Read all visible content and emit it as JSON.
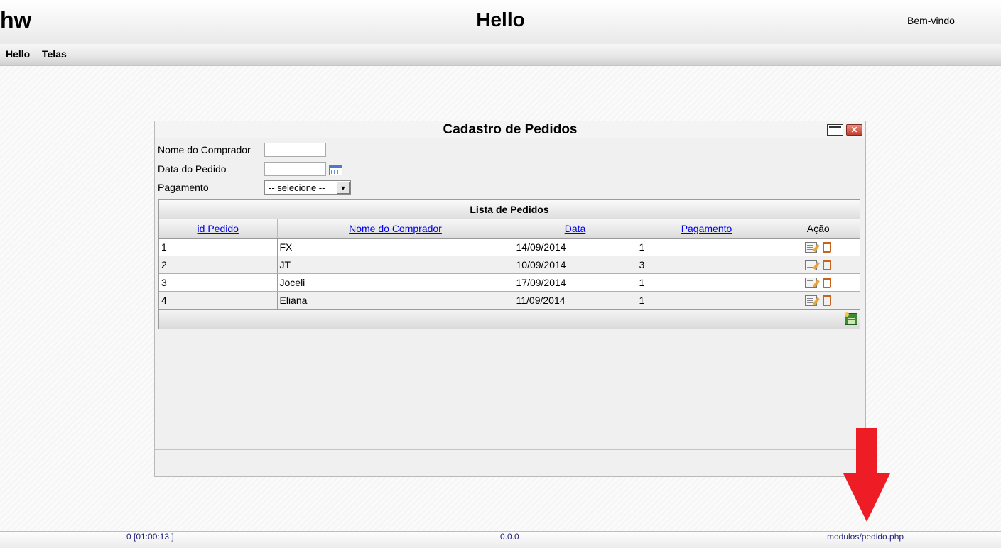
{
  "header": {
    "app_name": "hw",
    "title": "Hello",
    "welcome": "Bem-vindo"
  },
  "menu": {
    "items": [
      {
        "label": "Hello"
      },
      {
        "label": "Telas"
      }
    ]
  },
  "window": {
    "title": "Cadastro de Pedidos",
    "form": {
      "buyer_label": "Nome do Comprador",
      "buyer_value": "",
      "date_label": "Data do Pedido",
      "date_value": "",
      "payment_label": "Pagamento",
      "payment_selected": "-- selecione --"
    },
    "grid": {
      "caption": "Lista de Pedidos",
      "columns": [
        "id Pedido",
        "Nome do Comprador",
        "Data",
        "Pagamento",
        "Ação"
      ],
      "rows": [
        {
          "id": "1",
          "buyer": "FX",
          "date": "14/09/2014",
          "payment": "1"
        },
        {
          "id": "2",
          "buyer": "JT",
          "date": "10/09/2014",
          "payment": "3"
        },
        {
          "id": "3",
          "buyer": "Joceli",
          "date": "17/09/2014",
          "payment": "1"
        },
        {
          "id": "4",
          "buyer": "Eliana",
          "date": "11/09/2014",
          "payment": "1"
        }
      ]
    }
  },
  "footer": {
    "left": "0 [01:00:13 ]",
    "center": "0.0.0",
    "right": "modulos/pedido.php"
  },
  "colors": {
    "link": "#0000ee",
    "footer_text": "#1f1f7a",
    "arrow": "#ee1c24",
    "close_button": "#c2412f"
  }
}
